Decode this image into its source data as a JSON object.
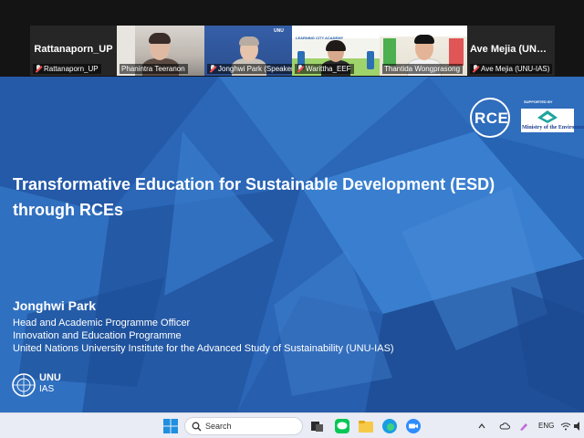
{
  "gallery": {
    "tiles": [
      {
        "name": "Rattanaporn_UP",
        "caption": "Rattanaporn_UP",
        "video": false
      },
      {
        "name": "Phanintra Teeranon",
        "caption": "Phanintra Teeranon",
        "video": true
      },
      {
        "name": "Jonghwi Park (Speaker)",
        "caption": "Jonghwi Park (Speaker)",
        "video": true
      },
      {
        "name": "Warittha_EEF",
        "caption": "Warittha_EEF",
        "video": true
      },
      {
        "name": "Thantida Wongprasong",
        "caption": "Thantida Wongprasong",
        "video": true,
        "active": true
      },
      {
        "name": "Ave Mejia (UNU-...",
        "caption": "Ave Mejia (UNU-IAS)",
        "video": false
      }
    ],
    "backdrop_banner": "LEARNING CITY ACADEMY"
  },
  "slide": {
    "rce_logo": "RCE",
    "supported_by": "SUPPORTED BY",
    "moe_label": "Ministry of the Environment",
    "title_line1": "Transformative Education for Sustainable Development (ESD)",
    "title_line2": "through RCEs",
    "presenter": "Jonghwi Park",
    "roles": [
      "Head and Academic Programme Officer",
      "Innovation and Education Programme",
      "United Nations University Institute for the Advanced Study of Sustainability (UNU-IAS)"
    ],
    "unu_name": "UNU",
    "unu_sub": "IAS",
    "colors": {
      "base": "#2a64b4",
      "dark": "#1b4f9c",
      "light": "#4a8bd6"
    }
  },
  "taskbar": {
    "search_label": "Search",
    "tray_lang": "ENG",
    "icons": [
      "windows-start-icon",
      "search-icon",
      "task-view-icon",
      "line-app-icon",
      "file-explorer-icon",
      "edge-browser-icon",
      "zoom-app-icon"
    ]
  }
}
